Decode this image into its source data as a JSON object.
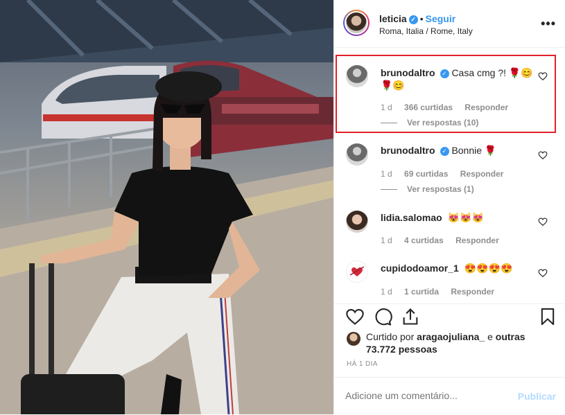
{
  "post": {
    "username": "leticia",
    "follow_label": "Seguir",
    "separator": "•",
    "location": "Roma, Italia / Rome, Italy",
    "more_icon": "more-icon"
  },
  "comments": [
    {
      "user": "brunodaltro",
      "text": "Casa cmg ?! 🌹😊 🌹😊",
      "time": "1 d",
      "likes": "366 curtidas",
      "reply": "Responder",
      "view_replies": "Ver respostas (10)"
    },
    {
      "user": "brunodaltro",
      "text": "Bonnie 🌹",
      "time": "1 d",
      "likes": "69 curtidas",
      "reply": "Responder",
      "view_replies": "Ver respostas (1)"
    },
    {
      "user": "lidia.salomao",
      "text": "😻😻😻",
      "time": "1 d",
      "likes": "4 curtidas",
      "reply": "Responder"
    },
    {
      "user": "cupidodoamor_1",
      "text": "😍😍😍😍",
      "time": "1 d",
      "likes": "1 curtida",
      "reply": "Responder"
    }
  ],
  "liked_by": {
    "prefix": "Curtido por",
    "user": "aragaojuliana_",
    "middle": "e",
    "others": "outras 73.772 pessoas"
  },
  "date": "HÁ 1 DIA",
  "add_comment": {
    "placeholder": "Adicione um comentário...",
    "post_label": "Publicar"
  },
  "colors": {
    "accent": "#3897f0",
    "highlight": "#e0202a",
    "muted": "#8e8e8e"
  }
}
